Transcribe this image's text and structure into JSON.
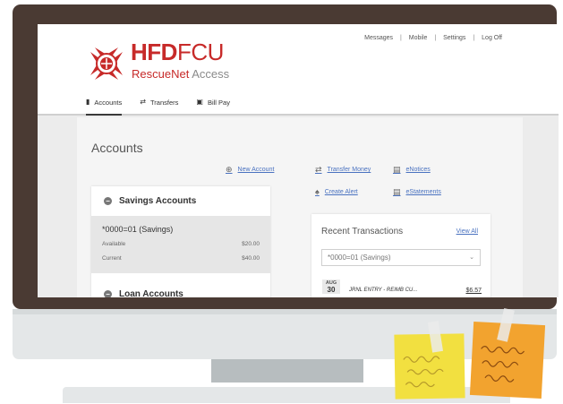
{
  "top_links": [
    "Messages",
    "Mobile",
    "Settings",
    "Log Off"
  ],
  "top_link_separator": "|",
  "brand": {
    "name_bold": "HFD",
    "name_thin": "FCU",
    "sub_strong": "RescueNet",
    "sub_light": " Access",
    "color": "#c72a29"
  },
  "nav": [
    {
      "label": "Accounts",
      "icon": "book-icon",
      "glyph": "▮",
      "active": true
    },
    {
      "label": "Transfers",
      "icon": "transfer-arrows-icon",
      "glyph": "⇄",
      "active": false
    },
    {
      "label": "Bill Pay",
      "icon": "calendar-icon",
      "glyph": "▣",
      "active": false
    }
  ],
  "page_title": "Accounts",
  "actions": {
    "new_account": "New Account",
    "transfer_money": "Transfer Money",
    "enotices": "eNotices",
    "create_alert": "Create Alert",
    "estatements": "eStatements"
  },
  "savings": {
    "heading": "Savings Accounts",
    "account_name": "*0000=01 (Savings)",
    "available_label": "Available",
    "available_value": "$20.00",
    "current_label": "Current",
    "current_value": "$40.00"
  },
  "loans": {
    "heading": "Loan Accounts"
  },
  "recent": {
    "heading": "Recent Transactions",
    "view_all": "View All",
    "select_value": "*0000=01 (Savings)",
    "transactions": [
      {
        "month": "AUG",
        "day": "30",
        "description": "JRNL ENTRY - REIMB CU...",
        "amount": "$6.57"
      }
    ]
  },
  "colors": {
    "link": "#4a72c0",
    "monitor_frame": "#4a3a33",
    "sticky_yellow": "#f2e040",
    "sticky_orange": "#f2a32f"
  }
}
